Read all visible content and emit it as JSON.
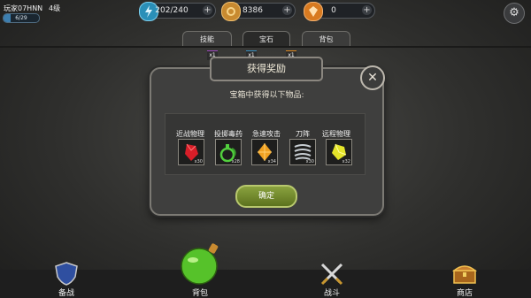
{
  "player": {
    "name": "玩家07HNN",
    "level": "4级",
    "xp_text": "6/29",
    "xp_fraction": 0.21
  },
  "resources": [
    {
      "icon": "energy-icon",
      "value": "202/240"
    },
    {
      "icon": "gold-coin-icon",
      "value": "8386"
    },
    {
      "icon": "gem-icon",
      "value": "0"
    }
  ],
  "tabs": [
    "技能",
    "宝石",
    "背包"
  ],
  "badges": [
    "x1",
    "x1",
    "x1"
  ],
  "dialog": {
    "title": "获得奖励",
    "subtitle": "宝箱中获得以下物品:",
    "items": [
      {
        "label": "近战物理",
        "count": "x30",
        "color": "#e0202a",
        "icon": "red-crystal-icon"
      },
      {
        "label": "投掷毒药",
        "count": "x28",
        "color": "#46c43a",
        "icon": "poison-flask-icon"
      },
      {
        "label": "急速攻击",
        "count": "x34",
        "color": "#f0a020",
        "icon": "orange-crystal-icon"
      },
      {
        "label": "刀阵",
        "count": "x30",
        "color": "#b9c2c8",
        "icon": "blade-vortex-icon"
      },
      {
        "label": "远程物理",
        "count": "x32",
        "color": "#e6e62a",
        "icon": "yellow-crystal-icon"
      }
    ],
    "ok_label": "确定"
  },
  "nav": [
    {
      "label": "备战",
      "icon": "shield-icon"
    },
    {
      "label": "背包",
      "icon": "potion-icon"
    },
    {
      "label": "战斗",
      "icon": "crossed-swords-icon"
    },
    {
      "label": "商店",
      "icon": "treasure-chest-icon"
    }
  ]
}
